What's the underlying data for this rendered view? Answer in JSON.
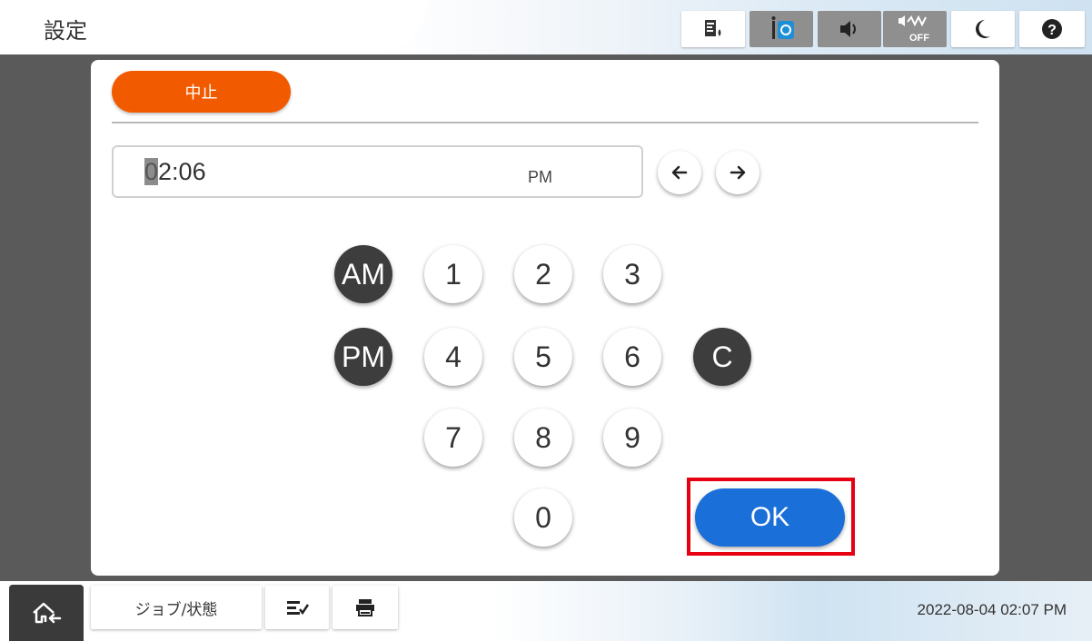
{
  "header": {
    "title": "設定",
    "status_icons": [
      "ink-level-icon",
      "network-status-icon",
      "sound-icon",
      "quiet-mode-off-icon",
      "sleep-moon-icon",
      "help-icon"
    ],
    "quiet_label": "OFF"
  },
  "dialog": {
    "cancel_label": "中止",
    "time_field": {
      "cursor_char": "0",
      "rest_value": "2:06",
      "period": "PM"
    },
    "keypad": {
      "am": "AM",
      "pm": "PM",
      "clear": "C",
      "digits": [
        "1",
        "2",
        "3",
        "4",
        "5",
        "6",
        "7",
        "8",
        "9",
        "0"
      ]
    },
    "ok_label": "OK",
    "highlight_color": "#e60012"
  },
  "footer": {
    "job_status_label": "ジョブ/状態",
    "datetime": "2022-08-04 02:07 PM"
  },
  "colors": {
    "cancel": "#f25a00",
    "ok": "#1a6fd8",
    "dark_key": "#3d3d3d"
  }
}
